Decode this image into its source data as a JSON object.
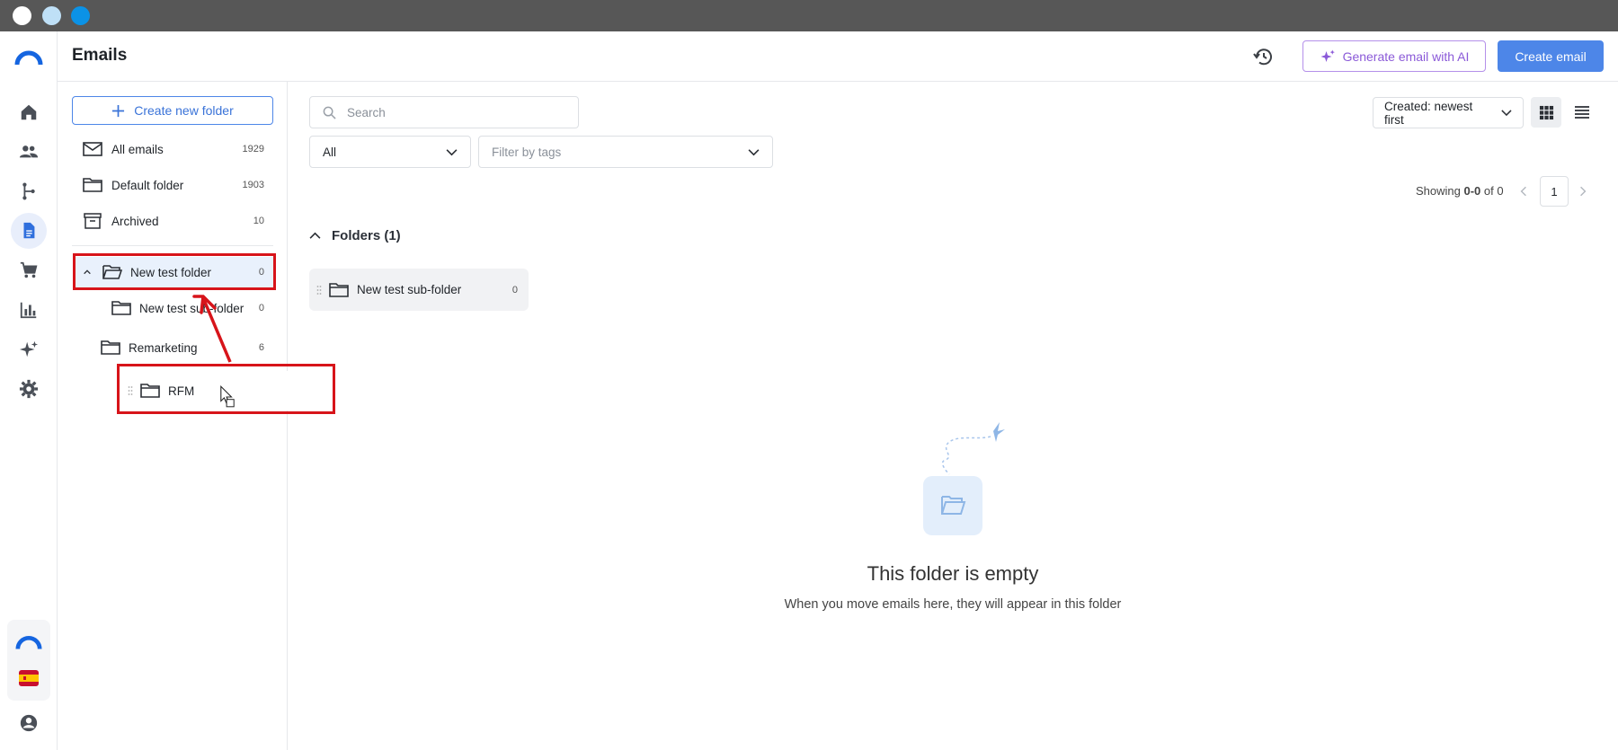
{
  "header": {
    "title": "Emails",
    "ai_button": "Generate email with AI",
    "create_button": "Create email"
  },
  "rail": {
    "items": [
      "home-icon",
      "contacts-icon",
      "automation-icon",
      "emails-icon",
      "ecommerce-icon",
      "reports-icon",
      "ai-sparkle-icon",
      "settings-icon"
    ],
    "active": "emails-icon",
    "bottom": [
      "brand-logo-icon",
      "spain-flag-icon",
      "account-icon"
    ]
  },
  "sidebar": {
    "create_folder": "Create new folder",
    "system_folders": [
      {
        "label": "All emails",
        "count": "1929"
      },
      {
        "label": "Default folder",
        "count": "1903"
      },
      {
        "label": "Archived",
        "count": "10"
      }
    ],
    "tree": [
      {
        "label": "New test folder",
        "count": "0"
      },
      {
        "label": "New test sub-folder",
        "count": "0"
      },
      {
        "label": "Remarketing",
        "count": "6"
      }
    ],
    "dragging": {
      "label": "RFM"
    }
  },
  "filters": {
    "search_placeholder": "Search",
    "type_value": "All",
    "tags_placeholder": "Filter by tags",
    "sort_value": "Created: newest first"
  },
  "pager": {
    "prefix": "Showing",
    "range": "0-0",
    "suffix": "of 0",
    "page": "1"
  },
  "folders_section": {
    "heading": "Folders (1)",
    "items": [
      {
        "label": "New test sub-folder",
        "count": "0"
      }
    ]
  },
  "empty": {
    "title": "This folder is empty",
    "subtitle": "When you move emails here, they will appear in this folder"
  },
  "colors": {
    "primary": "#4d86e8",
    "ai": "#8b5ad8",
    "annotation": "#d7141a",
    "selected_bg": "#e9f1fc"
  }
}
